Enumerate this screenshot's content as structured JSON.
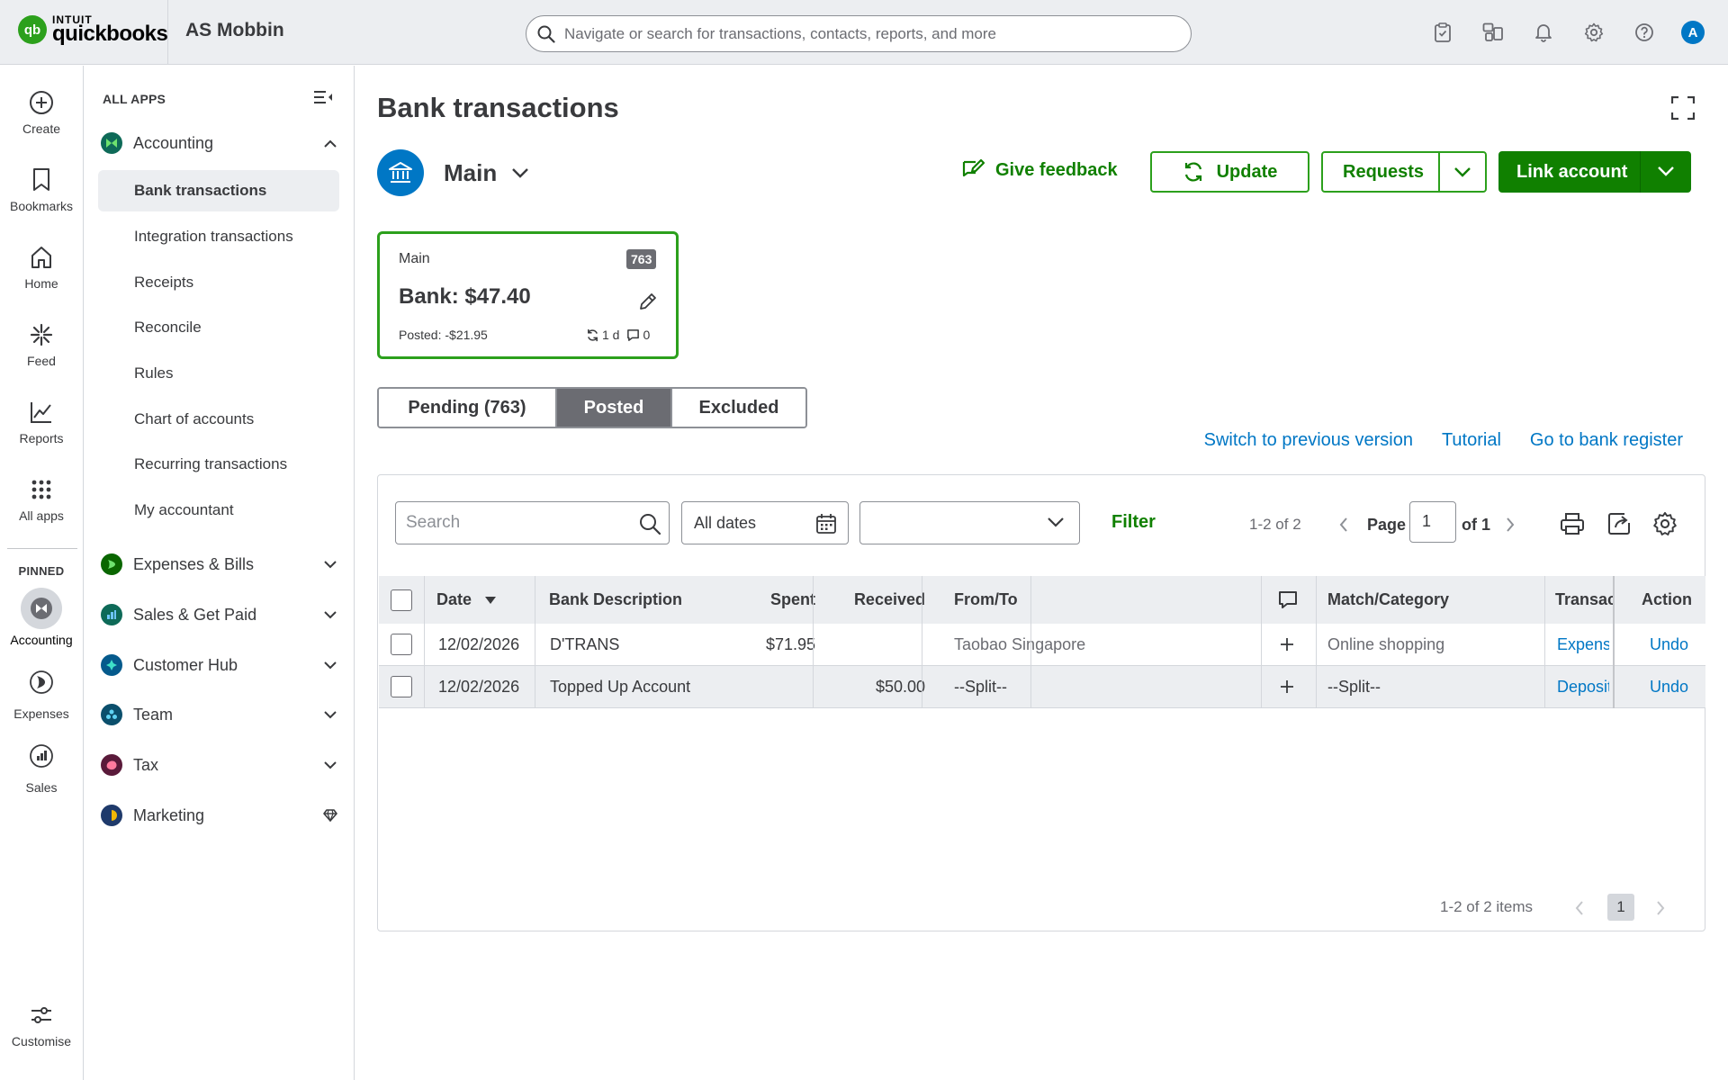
{
  "header": {
    "logo_intuit": "INTUIT",
    "logo_qb": "quickbooks",
    "logo_mark": "qb",
    "company": "AS Mobbin",
    "search_placeholder": "Navigate or search for transactions, contacts, reports, and more",
    "icons": [
      "clipboard-check-icon",
      "apps-switch-icon",
      "bell-icon",
      "gear-icon",
      "help-icon"
    ],
    "avatar": "A"
  },
  "rail": {
    "items": [
      {
        "label": "Create",
        "icon": "plus-circle-icon"
      },
      {
        "label": "Bookmarks",
        "icon": "bookmark-icon"
      },
      {
        "label": "Home",
        "icon": "home-icon"
      },
      {
        "label": "Feed",
        "icon": "sparkle-icon"
      },
      {
        "label": "Reports",
        "icon": "line-chart-icon"
      },
      {
        "label": "All apps",
        "icon": "grid-dots-icon"
      }
    ],
    "pinned_label": "PINNED",
    "pinned": [
      {
        "label": "Accounting"
      },
      {
        "label": "Expenses"
      },
      {
        "label": "Sales"
      }
    ],
    "customise": "Customise"
  },
  "sidenav": {
    "all_apps": "ALL APPS",
    "accounting": {
      "label": "Accounting",
      "items": [
        {
          "label": "Bank transactions",
          "active": true
        },
        {
          "label": "Integration transactions"
        },
        {
          "label": "Receipts"
        },
        {
          "label": "Reconcile"
        },
        {
          "label": "Rules"
        },
        {
          "label": "Chart of accounts"
        },
        {
          "label": "Recurring transactions"
        },
        {
          "label": "My accountant"
        }
      ]
    },
    "groups": [
      {
        "label": "Expenses & Bills",
        "color": "#108000"
      },
      {
        "label": "Sales & Get Paid",
        "color": "#0077c5"
      },
      {
        "label": "Customer Hub",
        "color": "#00a896"
      },
      {
        "label": "Team",
        "color": "#0e7fa6"
      },
      {
        "label": "Tax",
        "color": "#e0245e"
      },
      {
        "label": "Marketing",
        "color": "#f2b705"
      }
    ]
  },
  "main": {
    "title": "Bank transactions",
    "account_name": "Main",
    "give_feedback": "Give feedback",
    "update": "Update",
    "requests": "Requests",
    "link_account": "Link account",
    "card": {
      "name": "Main",
      "badge": "763",
      "bank": "Bank: $47.40",
      "posted": "Posted: -$21.95",
      "sync": "1 d",
      "comments": "0"
    },
    "tabs": [
      {
        "label": "Pending (763)"
      },
      {
        "label": "Posted",
        "active": true
      },
      {
        "label": "Excluded"
      }
    ],
    "links": [
      "Switch to previous version",
      "Tutorial",
      "Go to bank register"
    ]
  },
  "grid": {
    "search_placeholder": "Search",
    "dates": "All dates",
    "filter": "Filter",
    "range": "1-2 of 2",
    "page_label": "Page",
    "page_value": "1",
    "of_pages": "of 1",
    "columns": [
      "Date",
      "Bank Description",
      "Spent",
      "Received",
      "From/To",
      "Match/Category",
      "Transac",
      "Action"
    ],
    "rows": [
      {
        "date": "12/02/2026",
        "desc": "D'TRANS",
        "spent": "$71.95",
        "received": "",
        "fromto": "Taobao Singapore",
        "category": "Online shopping",
        "type": "Expense",
        "action": "Undo"
      },
      {
        "date": "12/02/2026",
        "desc": "Topped Up Account",
        "spent": "",
        "received": "$50.00",
        "fromto": "--Split--",
        "category": "--Split--",
        "type": "Deposit",
        "action": "Undo"
      }
    ],
    "footer_range": "1-2 of 2 items",
    "footer_page": "1"
  },
  "colors": {
    "brand_green": "#2ca01c",
    "dark_green": "#108000",
    "link_blue": "#0077c5"
  }
}
